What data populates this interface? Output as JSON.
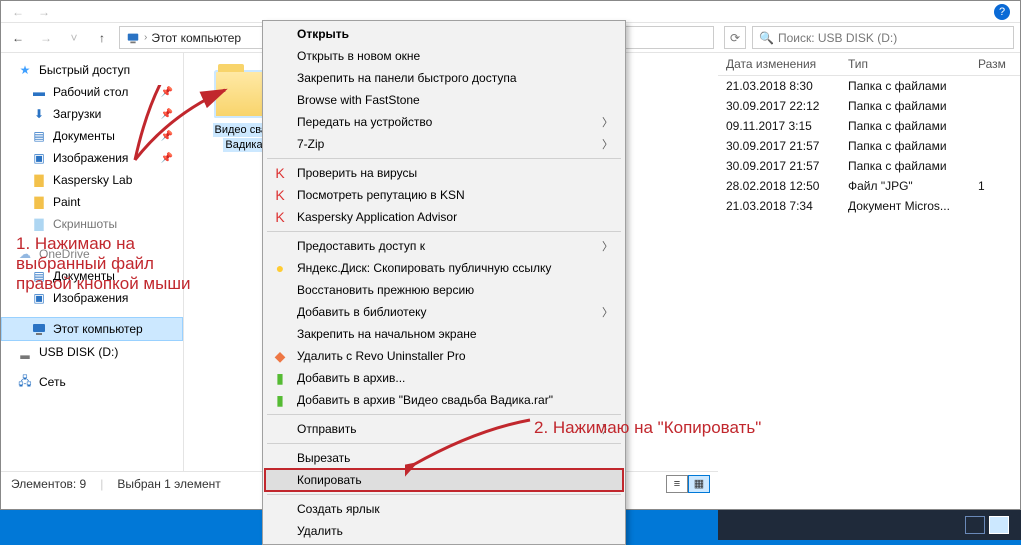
{
  "breadcrumb": {
    "label": "Этот компьютер",
    "sep": "›"
  },
  "search1_prefix": "×",
  "search2_placeholder": "Поиск: USB DISK (D:)",
  "sidebar": {
    "quick": {
      "label": "Быстрый доступ"
    },
    "desktop": {
      "label": "Рабочий стол"
    },
    "downloads": {
      "label": "Загрузки"
    },
    "documents": {
      "label": "Документы"
    },
    "pictures": {
      "label": "Изображения"
    },
    "kaspersky": {
      "label": "Kaspersky Lab"
    },
    "paint": {
      "label": "Paint"
    },
    "screenshots": {
      "label": "Скриншоты"
    },
    "onedrive": {
      "label": "OneDrive"
    },
    "od_docs": {
      "label": "Документы"
    },
    "od_pics": {
      "label": "Изображения"
    },
    "thispc": {
      "label": "Этот компьютер"
    },
    "usb": {
      "label": "USB DISK (D:)"
    },
    "network": {
      "label": "Сеть"
    }
  },
  "folder_selected": {
    "line1": "Видео свад",
    "line2": "Вадика"
  },
  "status": {
    "items": "Элементов: 9",
    "selected": "Выбран 1 элемент"
  },
  "columns": {
    "date": "Дата изменения",
    "type": "Тип",
    "size": "Разм"
  },
  "rows": [
    {
      "date": "21.03.2018 8:30",
      "type": "Папка с файлами",
      "size": ""
    },
    {
      "date": "30.09.2017 22:12",
      "type": "Папка с файлами",
      "size": ""
    },
    {
      "date": "09.11.2017 3:15",
      "type": "Папка с файлами",
      "size": ""
    },
    {
      "date": "30.09.2017 21:57",
      "type": "Папка с файлами",
      "size": ""
    },
    {
      "date": "30.09.2017 21:57",
      "type": "Папка с файлами",
      "size": ""
    },
    {
      "date": "28.02.2018 12:50",
      "type": "Файл \"JPG\"",
      "size": "1"
    },
    {
      "date": "21.03.2018 7:34",
      "type": "Документ Micros...",
      "size": ""
    }
  ],
  "menu": {
    "open": "Открыть",
    "open_new": "Открыть в новом окне",
    "pin_quick": "Закрепить на панели быстрого доступа",
    "faststone": "Browse with FastStone",
    "cast": "Передать на устройство",
    "sevenzip": "7-Zip",
    "scan": "Проверить на вирусы",
    "ksn": "Посмотреть репутацию в KSN",
    "kaa": "Kaspersky Application Advisor",
    "share": "Предоставить доступ к",
    "yadisk": "Яндекс.Диск: Скопировать публичную ссылку",
    "restore": "Восстановить прежнюю версию",
    "addlib": "Добавить в библиотеку",
    "pin_start": "Закрепить на начальном экране",
    "revo": "Удалить с Revo Uninstaller Pro",
    "archive": "Добавить в архив...",
    "archive_named": "Добавить в архив \"Видео свадьба Вадика.rar\"",
    "send": "Отправить",
    "cut": "Вырезать",
    "copy": "Копировать",
    "shortcut": "Создать ярлык",
    "delete": "Удалить"
  },
  "anno1": "1. Нажимаю на\nвыбранный файл\nправой кнопкой мыши",
  "anno2": "2. Нажимаю на \"Копировать\""
}
